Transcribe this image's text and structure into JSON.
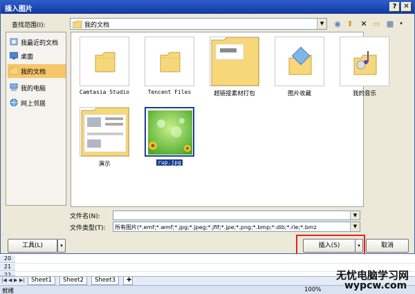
{
  "dialog": {
    "title": "插入图片",
    "help_btn": "?",
    "close_btn": "✕"
  },
  "lookin": {
    "label": "查找范围(I):",
    "value": "我的文档"
  },
  "places": [
    {
      "label": "我最近的文档",
      "icon": "recent-docs-icon"
    },
    {
      "label": "桌面",
      "icon": "desktop-icon"
    },
    {
      "label": "我的文档",
      "icon": "my-documents-icon",
      "selected": true
    },
    {
      "label": "我的电脑",
      "icon": "my-computer-icon"
    },
    {
      "label": "网上邻居",
      "icon": "network-icon"
    }
  ],
  "files": [
    {
      "name": "Camtasia Studio",
      "type": "folder"
    },
    {
      "name": "Tencent Files",
      "type": "folder"
    },
    {
      "name": "超链接素材打包",
      "type": "folder-open"
    },
    {
      "name": "图片收藏",
      "type": "folder-pictures"
    },
    {
      "name": "我的音乐",
      "type": "folder-music"
    },
    {
      "name": "演示",
      "type": "folder-preview"
    },
    {
      "name": "rup.jpg",
      "type": "image",
      "selected": true
    }
  ],
  "filename": {
    "label": "文件名(N):",
    "value": ""
  },
  "filetype": {
    "label": "文件类型(T):",
    "value": "所有图片(*.emf;*.wmf;*.jpg;*.jpeg;*.jfif;*.jpe;*.png;*.bmp;*.dib;*.rle;*.bmz"
  },
  "buttons": {
    "tools": "工具(L)",
    "insert": "插入(S)",
    "cancel": "取消"
  },
  "sheet": {
    "rows": [
      "20",
      "21",
      "22"
    ],
    "tabs": [
      "Sheet1",
      "Sheet2",
      "Sheet3"
    ],
    "status": "就绪",
    "zoom": "100%"
  },
  "watermark": {
    "line1": "无忧电脑学习网",
    "line2": "wypcw.com"
  },
  "colors": {
    "title_bar": "#1a46b0",
    "selection": "#1a3c94",
    "folder": "#f6d77a",
    "highlight": "#e0221c"
  }
}
